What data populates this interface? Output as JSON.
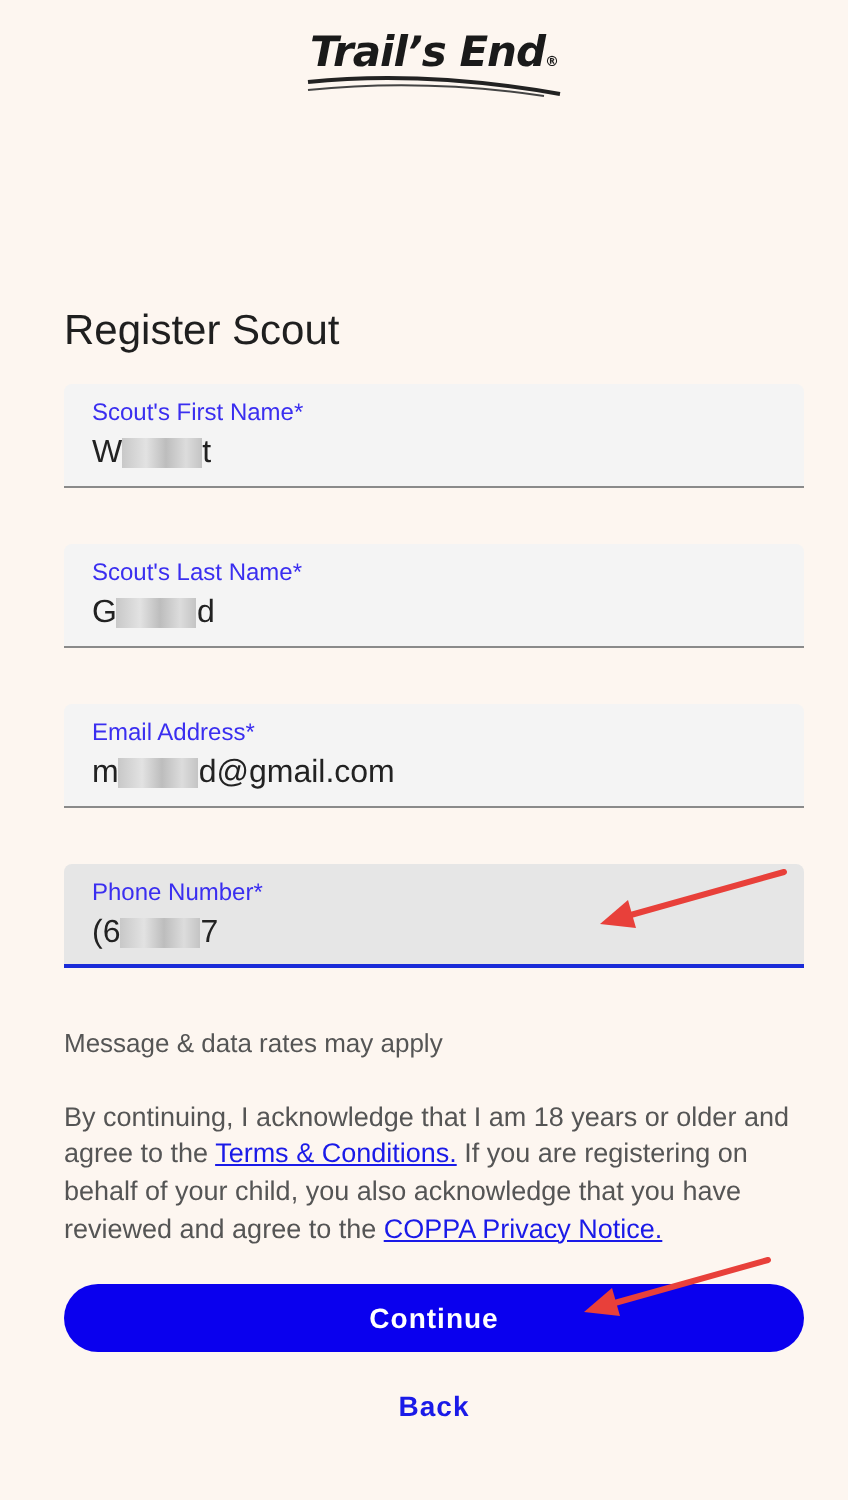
{
  "logo": {
    "text": "Trail’s End",
    "mark": "®"
  },
  "heading": "Register Scout",
  "fields": [
    {
      "label": "Scout's First Name*",
      "value_head": "W",
      "value_tail": "t",
      "redacted": true,
      "focused": false,
      "pointed_at": false
    },
    {
      "label": "Scout's Last Name*",
      "value_head": "G",
      "value_tail": "d",
      "redacted": true,
      "focused": false,
      "pointed_at": false
    },
    {
      "label": "Email Address*",
      "value_head": "m",
      "value_tail": "d@gmail.com",
      "redacted": true,
      "focused": false,
      "pointed_at": false
    },
    {
      "label": "Phone Number*",
      "value_head": "(6",
      "value_tail": "7",
      "redacted": true,
      "focused": true,
      "pointed_at": true
    }
  ],
  "helper": "Message & data rates may apply",
  "consent": [
    {
      "kind": "text",
      "text": "By continuing, I acknowledge that I am 18 years or older and agree to the "
    },
    {
      "kind": "link",
      "text": "Terms & Conditions."
    },
    {
      "kind": "text",
      "text": " If you are registering on behalf of your child, you also acknowledge that you have reviewed and agree to the "
    },
    {
      "kind": "link",
      "text": "COPPA Privacy Notice."
    }
  ],
  "continue_button": {
    "label": "Continue",
    "pointed_at": true
  },
  "back_link": "Back"
}
